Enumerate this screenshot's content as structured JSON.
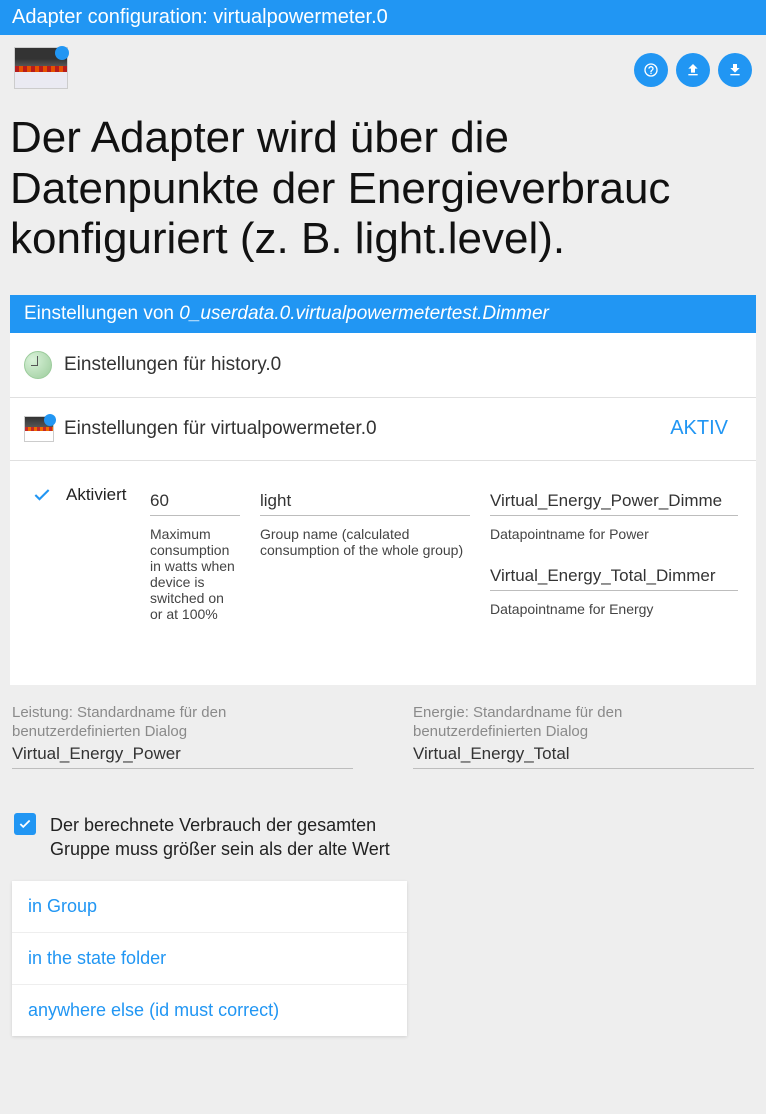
{
  "header": {
    "title": "Adapter configuration: virtualpowermeter.0"
  },
  "title": "Der Adapter wird über die Datenpunkte der Energieverbrauc konfiguriert (z. B. light.level).",
  "section": {
    "prefix": "Einstellungen von ",
    "target": "0_userdata.0.virtualpowermetertest.Dimmer"
  },
  "panel": {
    "row_history": "Einstellungen für history.0",
    "row_vpm": "Einstellungen für virtualpowermeter.0",
    "status": "AKTIV"
  },
  "config": {
    "activated_label": "Aktiviert",
    "max_value": "60",
    "max_helper": "Maximum consumption in watts when device is switched on or at 100%",
    "group_value": "light",
    "group_helper": "Group name (calculated consumption of the whole group)",
    "dp_power": "Virtual_Energy_Power_Dimme",
    "dp_power_helper": "Datapointname for Power",
    "dp_energy": "Virtual_Energy_Total_Dimmer",
    "dp_energy_helper": "Datapointname for Energy"
  },
  "lower": {
    "power_label": "Leistung: Standardname für den benutzerdefinierten Dialog",
    "power_value": "Virtual_Energy_Power",
    "energy_label": "Energie: Standardname für den benutzerdefinierten Dialog",
    "energy_value": "Virtual_Energy_Total"
  },
  "checkbox_sentence": "Der berechnete Verbrauch der gesamten Gruppe muss größer sein als der alte Wert",
  "options": {
    "opt1": "in Group",
    "opt2": "in the state folder",
    "opt3": "anywhere else (id must correct)"
  }
}
